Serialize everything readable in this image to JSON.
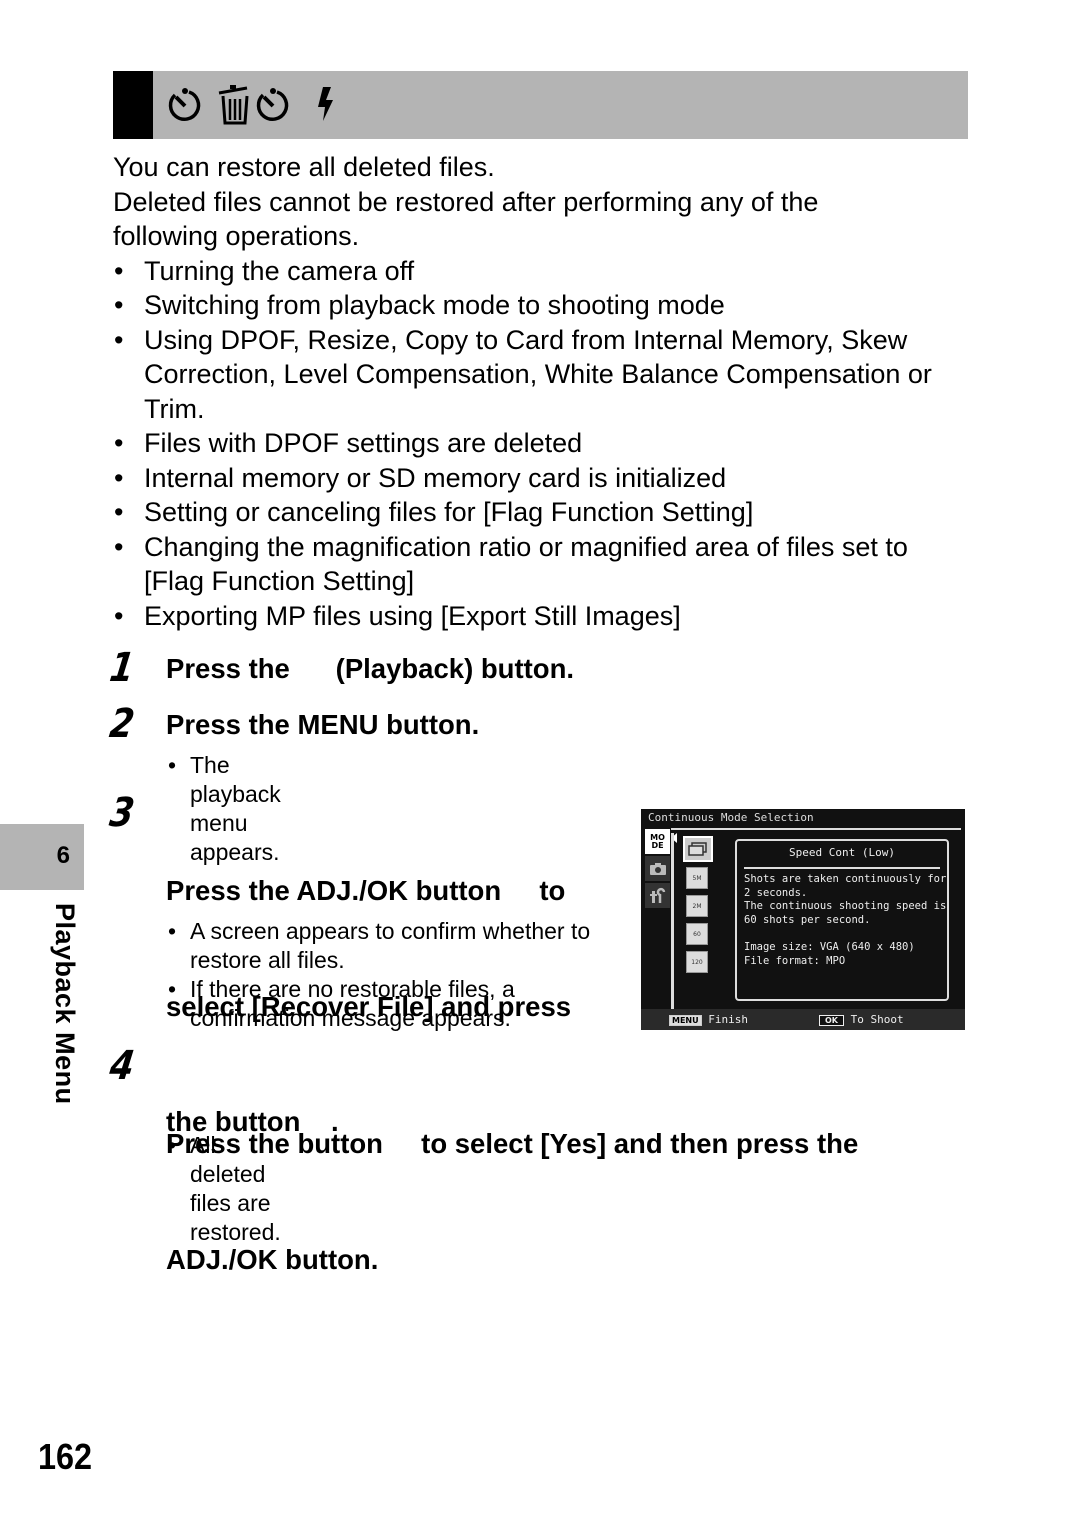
{
  "header": {
    "icons": [
      "self-timer-icon",
      "trash-timer-icon",
      "flash-icon"
    ]
  },
  "intro": {
    "line1": "You can restore all deleted files.",
    "line2": "Deleted files cannot be restored after performing any of the following operations.",
    "operations": [
      "Turning the camera off",
      "Switching from playback mode to shooting mode",
      "Using DPOF, Resize, Copy to Card from Internal Memory, Skew Correction, Level Compensation, White Balance Compensation or Trim.",
      "Files with DPOF settings are deleted",
      "Internal memory or SD memory card is initialized",
      "Setting or canceling files for [Flag Function Setting]",
      "Changing the magnification ratio or magnified area of files set to [Flag Function Setting]",
      "Exporting MP files using [Export Still Images]"
    ]
  },
  "steps": [
    {
      "number": "1",
      "title": "Press the      (Playback) button.",
      "notes": []
    },
    {
      "number": "2",
      "title": "Press the MENU button.",
      "notes": [
        "The playback menu appears."
      ]
    },
    {
      "number": "3",
      "title_lines": [
        "Press the ADJ./OK button     to",
        "select [Recover File] and press",
        "the button    ."
      ],
      "notes": [
        "A screen appears to confirm whether to restore all files.",
        "If there are no restorable files, a confirmation message appears."
      ]
    },
    {
      "number": "4",
      "title_lines": [
        "Press the button     to select [Yes] and then press the",
        "ADJ./OK button."
      ],
      "notes": [
        "All deleted files are restored."
      ]
    }
  ],
  "camera_screen": {
    "title": "Continuous Mode Selection",
    "tabs": [
      {
        "label": "MO\nDE",
        "icon": "mode-icon",
        "active": true
      },
      {
        "label": "",
        "icon": "camera-icon",
        "active": false
      },
      {
        "label": "",
        "icon": "setup-wrench-icon",
        "active": false
      }
    ],
    "options": [
      {
        "icon": "continuous-icon",
        "sub": "",
        "selected": true
      },
      {
        "icon": "m-cont-5m-icon",
        "sub": "5M",
        "selected": false
      },
      {
        "icon": "m-cont-2m-icon",
        "sub": "2M",
        "selected": false
      },
      {
        "icon": "speed-cont-60-icon",
        "sub": "60",
        "selected": false
      },
      {
        "icon": "speed-cont-120-icon",
        "sub": "120",
        "selected": false
      }
    ],
    "desc_title": "Speed Cont (Low)",
    "desc_body": "Shots are taken continuously for\n2 seconds.\nThe continuous shooting speed is\n60 shots per second.\n\nImage size: VGA (640 x 480)\nFile format: MPO",
    "footer": {
      "menu_key": "MENU",
      "menu_label": "Finish",
      "ok_key": "OK",
      "ok_label": "To Shoot"
    }
  },
  "side": {
    "chapter_number": "6",
    "chapter_label": "Playback Menu"
  },
  "page_number": "162"
}
